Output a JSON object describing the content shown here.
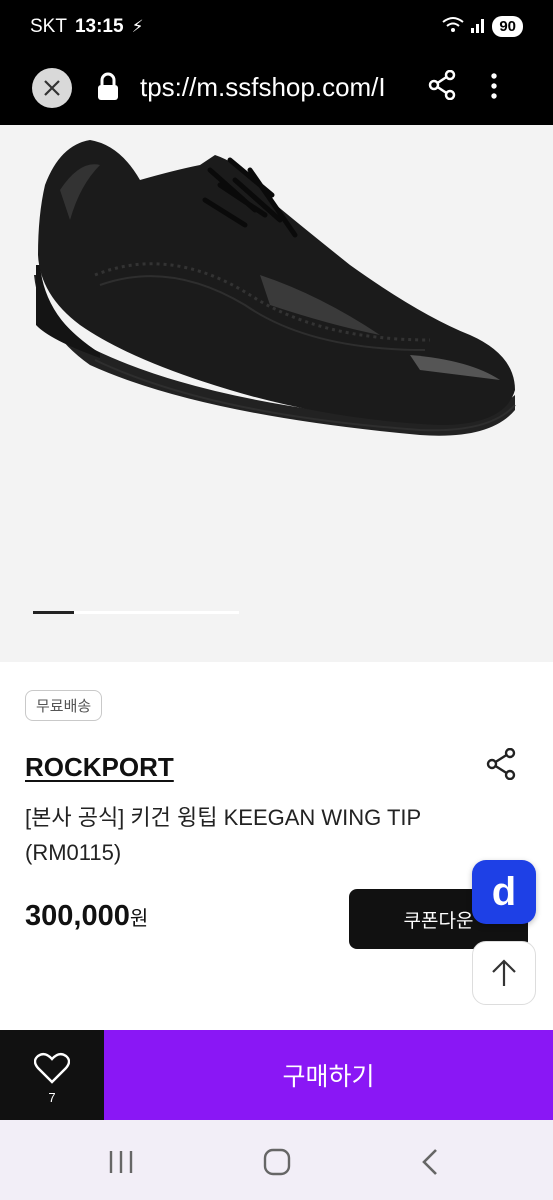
{
  "status": {
    "carrier": "SKT",
    "time": "13:15",
    "battery": "90"
  },
  "browser": {
    "url": "tps://m.ssfshop.com/I"
  },
  "product": {
    "badge": "무료배송",
    "brand": "ROCKPORT",
    "title": "[본사 공식] 키건 윙팁 KEEGAN WING TIP (RM0115)",
    "price": "300,000",
    "currency": "원",
    "coupon_label": "쿠폰다운",
    "image_count_indicator": {
      "active_index": 0
    }
  },
  "floating": {
    "d_label": "d"
  },
  "bottom": {
    "wish_count": "7",
    "buy_label": "구매하기"
  },
  "colors": {
    "buy": "#8a17f5",
    "d_button": "#1e40e6"
  },
  "icons": [
    "close-icon",
    "lock-icon",
    "share-icon",
    "more-icon",
    "share-icon",
    "heart-icon",
    "arrow-up-icon",
    "recent-apps-icon",
    "home-icon",
    "back-icon"
  ]
}
